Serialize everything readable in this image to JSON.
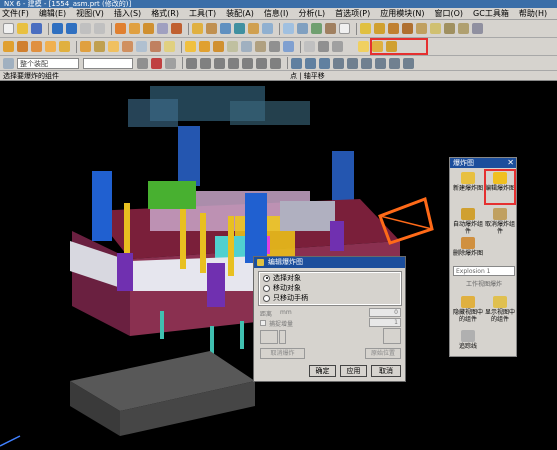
{
  "window": {
    "title": "NX 6 - 建模 - [1554_asm.prt (修改的)]"
  },
  "menu": [
    "文件(F)",
    "编辑(E)",
    "视图(V)",
    "插入(S)",
    "格式(R)",
    "工具(T)",
    "装配(A)",
    "信息(I)",
    "分析(L)",
    "首选项(P)",
    "应用模块(N)",
    "窗口(O)",
    "GC工具箱",
    "帮助(H)"
  ],
  "toolbar": {
    "filter_value": "整个装配",
    "filter_placeholder": ""
  },
  "hints": {
    "left": "选择要爆炸的组件",
    "center": "点 | 轴平移"
  },
  "colors": {
    "highlight": "#e53030",
    "titlebar": "#1c4e9c",
    "panel_bg": "#d6d3ce"
  },
  "explode_panel": {
    "title": "爆炸图",
    "close": "✕",
    "buttons": [
      {
        "label": "新建爆炸图",
        "icon": "new-explosion-icon"
      },
      {
        "label": "编辑爆炸图",
        "icon": "edit-explosion-icon"
      },
      {
        "label": "自动爆炸组件",
        "icon": "auto-explode-icon"
      },
      {
        "label": "取消爆炸组件",
        "icon": "unexplode-icon"
      },
      {
        "label": "删除爆炸图",
        "icon": "delete-explosion-icon"
      },
      {
        "label": "隐藏视图中的组件",
        "icon": "hide-component-icon"
      },
      {
        "label": "显示视图中的组件",
        "icon": "show-component-icon"
      },
      {
        "label": "追踪线",
        "icon": "tracelines-icon"
      }
    ],
    "combo_value": "Explosion 1",
    "combo_label": "工作视图爆炸"
  },
  "dialog": {
    "title": "编辑爆炸图",
    "options": [
      "选择对象",
      "移动对象",
      "只移动手柄"
    ],
    "selected_index": 0,
    "distance_label": "距离",
    "distance_unit": "mm",
    "distance_value": "0",
    "snap_label": "捕捉增量",
    "snap_value": "1",
    "cancel_explode_label": "取消爆炸",
    "origin_label": "原始位置",
    "buttons": {
      "ok": "确定",
      "apply": "应用",
      "cancel": "取消"
    }
  }
}
